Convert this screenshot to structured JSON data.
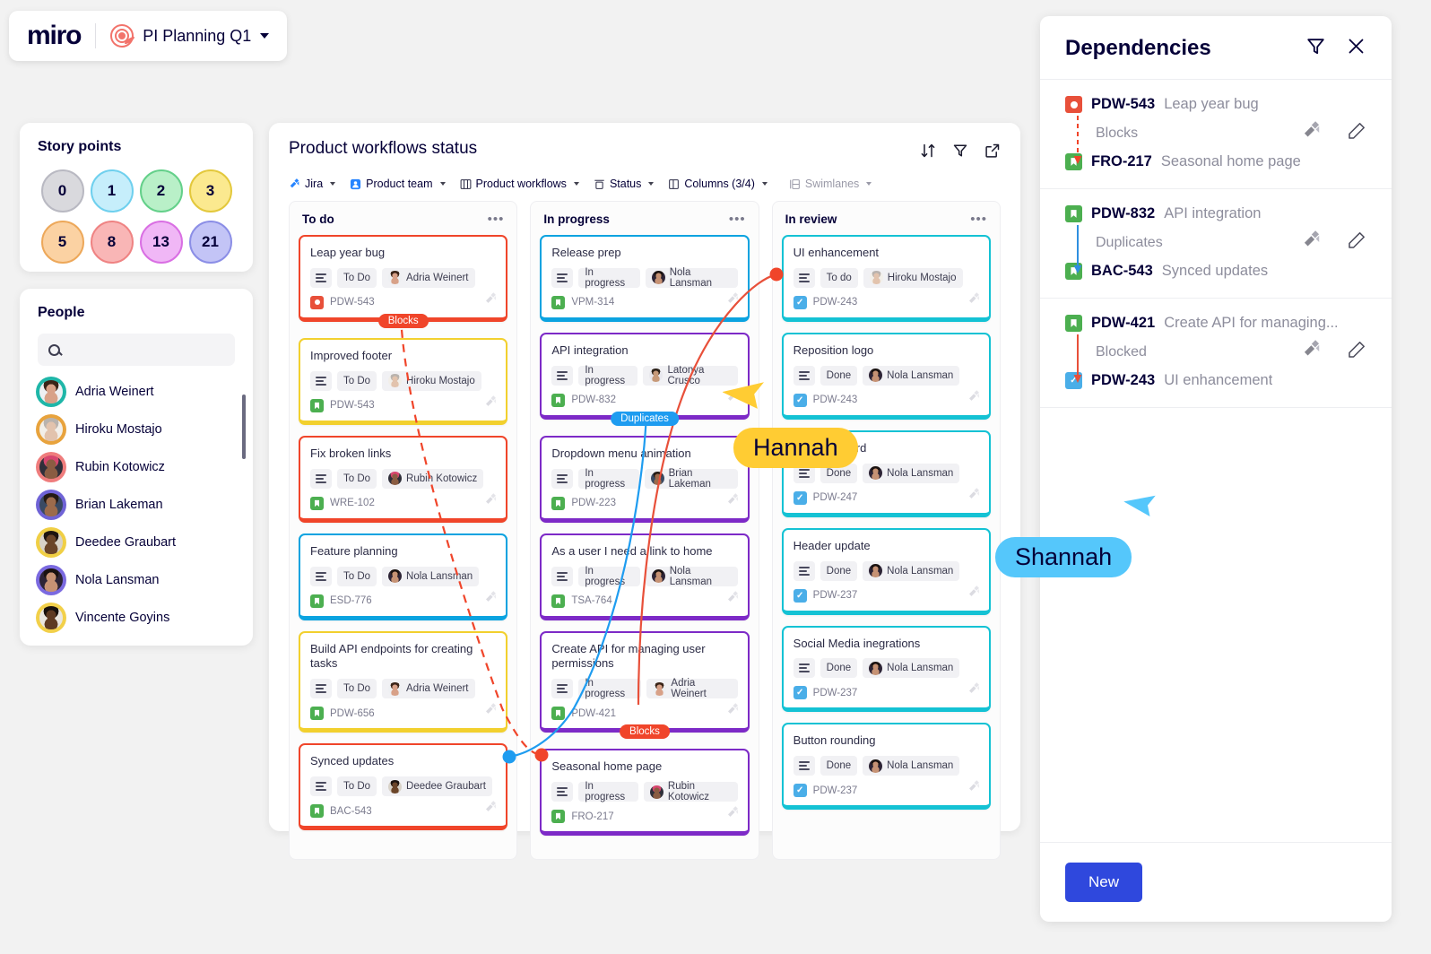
{
  "app": {
    "logo_text": "miro",
    "board_name": "PI Planning Q1",
    "board_icon": "target-icon",
    "chevron": "chevron-down-icon"
  },
  "story_points": {
    "title": "Story points",
    "values": [
      {
        "label": "0",
        "bg": "#d9d9dd",
        "border": "#b9b9c2"
      },
      {
        "label": "1",
        "bg": "#c6eefb",
        "border": "#6fd0ee"
      },
      {
        "label": "2",
        "bg": "#b9f0c8",
        "border": "#64d08a"
      },
      {
        "label": "3",
        "bg": "#fbe98f",
        "border": "#e3c83c"
      },
      {
        "label": "5",
        "bg": "#fbd2a3",
        "border": "#eda85a"
      },
      {
        "label": "8",
        "bg": "#f9b6b6",
        "border": "#ef8383"
      },
      {
        "label": "13",
        "bg": "#f0b7f6",
        "border": "#d96fe3"
      },
      {
        "label": "21",
        "bg": "#c3c4f6",
        "border": "#8b8ee6"
      }
    ]
  },
  "people": {
    "title": "People",
    "search_placeholder": "",
    "search_value": "",
    "members": [
      {
        "name": "Adria Weinert",
        "ring": "#1fb6a8",
        "skin": "#d8a188",
        "hair": "#3a2418",
        "shirt": "#eef0f3"
      },
      {
        "name": "Hiroku Mostajo",
        "ring": "#e8a33d",
        "skin": "#e2c3ad",
        "hair": "#b9b3ae",
        "shirt": "#f2efe9"
      },
      {
        "name": "Rubin Kotowicz",
        "ring": "#ef7d7d",
        "skin": "#8a5c42",
        "hair": "#d7466f",
        "shirt": "#2f2f3a"
      },
      {
        "name": "Brian Lakeman",
        "ring": "#6f63d6",
        "skin": "#9c6b4c",
        "hair": "#241a14",
        "shirt": "#394a63"
      },
      {
        "name": "Deedee Graubart",
        "ring": "#f0cf45",
        "skin": "#6b4529",
        "hair": "#1d1410",
        "shirt": "#d8d2c8"
      },
      {
        "name": "Nola Lansman",
        "ring": "#7b6ae0",
        "skin": "#c69274",
        "hair": "#1a1210",
        "shirt": "#2d2436"
      },
      {
        "name": "Vincente Goyins",
        "ring": "#f2d04a",
        "skin": "#5e3a22",
        "hair": "#17100c",
        "shirt": "#e9e6e0"
      }
    ]
  },
  "board": {
    "title": "Product workflows status",
    "header_actions": [
      {
        "name": "sort-icon",
        "label": "Sort"
      },
      {
        "name": "filter-icon",
        "label": "Filter"
      },
      {
        "name": "open-external-icon",
        "label": "Open"
      }
    ],
    "toolbar": [
      {
        "label": "Jira",
        "icon": "jira-icon",
        "muted": false
      },
      {
        "label": "Product team",
        "icon": "team-icon",
        "muted": false
      },
      {
        "label": "Product workflows",
        "icon": "board-icon",
        "muted": false
      },
      {
        "label": "Status",
        "icon": "status-icon",
        "muted": false
      },
      {
        "label": "Columns (3/4)",
        "icon": "columns-icon",
        "muted": false
      },
      {
        "label": "Swimlanes",
        "icon": "swimlanes-icon",
        "muted": true
      }
    ],
    "columns": [
      {
        "title": "To do",
        "cards": [
          {
            "title": "Leap year bug",
            "status": "To Do",
            "assignee": "Adria Weinert",
            "key": "PDW-543",
            "color": "#f0452a",
            "type": "bug",
            "badge": {
              "label": "Blocks",
              "color": "#f0452a",
              "pos": "bottom"
            }
          },
          {
            "title": "Improved footer",
            "status": "To Do",
            "assignee": "Hiroku Mostajo",
            "key": "PDW-543",
            "color": "#f2d02e",
            "type": "story"
          },
          {
            "title": "Fix broken links",
            "status": "To Do",
            "assignee": "Rubin Kotowicz",
            "key": "WRE-102",
            "color": "#f0452a",
            "type": "story"
          },
          {
            "title": "Feature planning",
            "status": "To Do",
            "assignee": "Nola Lansman",
            "key": "ESD-776",
            "color": "#0ba3e0",
            "type": "story"
          },
          {
            "title": "Build API endpoints for creating tasks",
            "status": "To Do",
            "assignee": "Adria Weinert",
            "key": "PDW-656",
            "color": "#f2d02e",
            "type": "story"
          },
          {
            "title": "Synced updates",
            "status": "To Do",
            "assignee": "Deedee Graubart",
            "key": "BAC-543",
            "color": "#f0452a",
            "type": "story"
          }
        ]
      },
      {
        "title": "In progress",
        "cards": [
          {
            "title": "Release prep",
            "status": "In progress",
            "assignee": "Nola Lansman",
            "key": "VPM-314",
            "color": "#0ba3e0",
            "type": "story"
          },
          {
            "title": "API integration",
            "status": "In progress",
            "assignee": "Latonya Crusco",
            "key": "PDW-832",
            "color": "#7d2ac7",
            "type": "story",
            "badge": {
              "label": "Duplicates",
              "color": "#1e9cf0",
              "pos": "bottom"
            }
          },
          {
            "title": "Dropdown menu animation",
            "status": "In progress",
            "assignee": "Brian Lakeman",
            "key": "PDW-223",
            "color": "#7d2ac7",
            "type": "story"
          },
          {
            "title": "As a user I need a link to home",
            "status": "In progress",
            "assignee": "Nola Lansman",
            "key": "TSA-764",
            "color": "#7d2ac7",
            "type": "story"
          },
          {
            "title": "Create API for managing user permissions",
            "status": "In progress",
            "assignee": "Adria Weinert",
            "key": "PDW-421",
            "color": "#7d2ac7",
            "type": "story",
            "badge": {
              "label": "Blocks",
              "color": "#f0452a",
              "pos": "bottom"
            }
          },
          {
            "title": "Seasonal home page",
            "status": "In progress",
            "assignee": "Rubin Kotowicz",
            "key": "FRO-217",
            "color": "#7d2ac7",
            "type": "story"
          }
        ]
      },
      {
        "title": "In review",
        "cards": [
          {
            "title": "UI enhancement",
            "status": "To do",
            "assignee": "Hiroku Mostajo",
            "key": "PDW-243",
            "color": "#14c2d4",
            "type": "task"
          },
          {
            "title": "Reposition logo",
            "status": "Done",
            "assignee": "Nola Lansman",
            "key": "PDW-243",
            "color": "#14c2d4",
            "type": "task"
          },
          {
            "title": "Rounded card",
            "status": "Done",
            "assignee": "Nola Lansman",
            "key": "PDW-247",
            "color": "#14c2d4",
            "type": "task"
          },
          {
            "title": "Header update",
            "status": "Done",
            "assignee": "Nola Lansman",
            "key": "PDW-237",
            "color": "#14c2d4",
            "type": "task"
          },
          {
            "title": "Social Media inegrations",
            "status": "Done",
            "assignee": "Nola Lansman",
            "key": "PDW-237",
            "color": "#14c2d4",
            "type": "task"
          },
          {
            "title": "Button rounding",
            "status": "Done",
            "assignee": "Nola Lansman",
            "key": "PDW-237",
            "color": "#14c2d4",
            "type": "task"
          }
        ]
      }
    ]
  },
  "cursors": [
    {
      "name": "Hannah",
      "color": "#ffcc33",
      "text_color": "#050038"
    },
    {
      "name": "Shannah",
      "color": "#55c7fb",
      "text_color": "#050038"
    }
  ],
  "dependencies": {
    "title": "Dependencies",
    "filter_icon": "filter-icon",
    "close_icon": "close-icon",
    "items": [
      {
        "from_key": "PDW-543",
        "from_summary": "Leap year bug",
        "from_type": "bug",
        "relation": "Blocks",
        "arrow_color": "#f0452a",
        "arrow_style": "dashed",
        "to_key": "FRO-217",
        "to_summary": "Seasonal home page",
        "to_type": "story"
      },
      {
        "from_key": "PDW-832",
        "from_summary": "API integration",
        "from_type": "story",
        "relation": "Duplicates",
        "arrow_color": "#2f8fe0",
        "arrow_style": "solid",
        "to_key": "BAC-543",
        "to_summary": "Synced updates",
        "to_type": "story"
      },
      {
        "from_key": "PDW-421",
        "from_summary": "Create API for managing...",
        "from_type": "story",
        "relation": "Blocked",
        "arrow_color": "#e8503a",
        "arrow_style": "solid",
        "to_key": "PDW-243",
        "to_summary": "UI enhancement",
        "to_type": "task"
      }
    ],
    "row_icons": [
      {
        "name": "jira-icon",
        "label": "Jira"
      },
      {
        "name": "edit-pencil-icon",
        "label": "Edit"
      }
    ],
    "new_button": "New"
  }
}
